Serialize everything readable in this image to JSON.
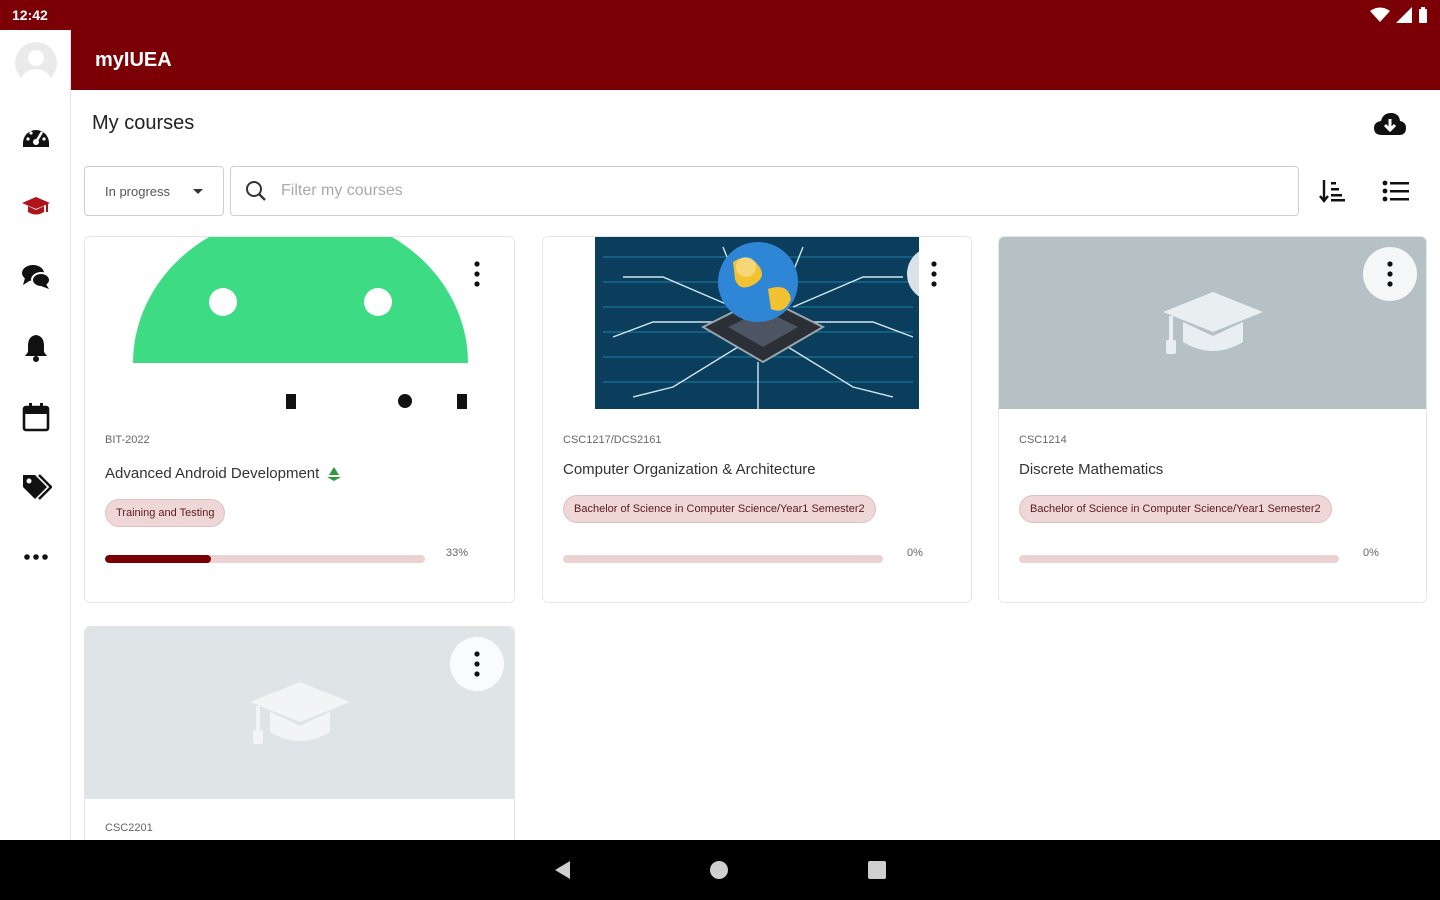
{
  "status_bar": {
    "time": "12:42"
  },
  "app": {
    "title": "myIUEA"
  },
  "rail": {
    "items": [
      {
        "name": "dashboard",
        "icon": "dashboard-gauge-icon"
      },
      {
        "name": "my-courses",
        "icon": "graduation-cap-icon",
        "active": true
      },
      {
        "name": "messages",
        "icon": "chat-bubbles-icon"
      },
      {
        "name": "notifications",
        "icon": "bell-icon"
      },
      {
        "name": "calendar",
        "icon": "calendar-icon"
      },
      {
        "name": "tags",
        "icon": "tags-icon"
      },
      {
        "name": "more",
        "icon": "more-horizontal-icon"
      }
    ]
  },
  "page": {
    "title": "My courses",
    "download_icon": "cloud-download-icon"
  },
  "filter": {
    "status_value": "In progress",
    "search_placeholder": "Filter my courses",
    "sort_icon": "sort-ascending-icon",
    "view_icon": "list-view-icon"
  },
  "courses": [
    {
      "code": "BIT-2022",
      "name": "Advanced Android Development",
      "tag": "Training and Testing",
      "progress_pct": 33,
      "progress_label": "33%",
      "image": "android-logo"
    },
    {
      "code": "CSC1217/DCS2161",
      "name": "Computer Organization & Architecture",
      "tag": "Bachelor of Science in Computer Science/Year1 Semester2",
      "progress_pct": 0,
      "progress_label": "0%",
      "image": "cpu-globe"
    },
    {
      "code": "CSC1214",
      "name": "Discrete Mathematics",
      "tag": "Bachelor of Science in Computer Science/Year1 Semester2",
      "progress_pct": 0,
      "progress_label": "0%",
      "image": "placeholder-cap"
    },
    {
      "code": "CSC2201",
      "image": "placeholder-cap"
    }
  ],
  "colors": {
    "brand": "#7a0005",
    "tag_bg": "#efd6d7",
    "placeholder": "#b6c1c6"
  }
}
